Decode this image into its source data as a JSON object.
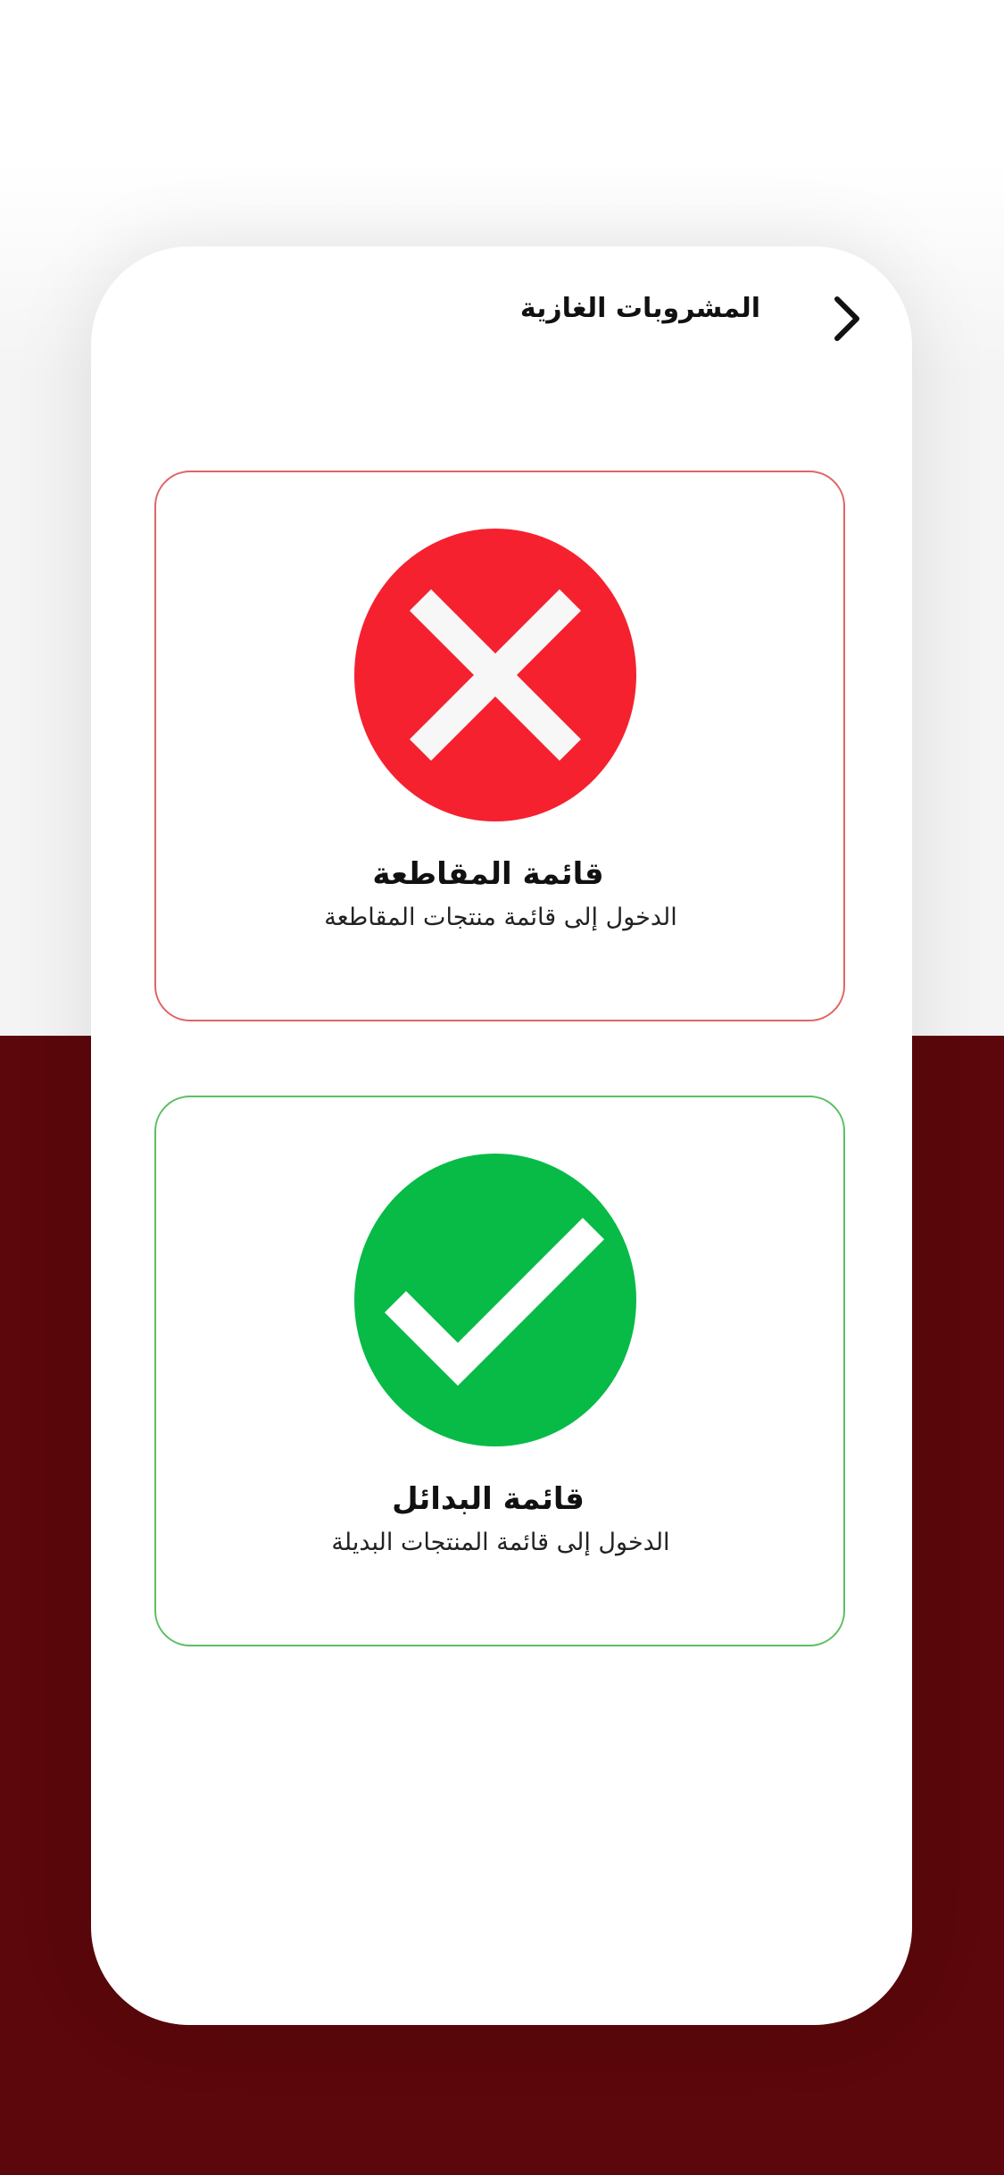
{
  "header": {
    "title": "المشروبات الغازية",
    "back_icon": "chevron-right-icon"
  },
  "cards": [
    {
      "title": "قائمة المقاطعة",
      "subtitle": "الدخول إلى قائمة منتجات المقاطعة",
      "icon": "x-circle-icon",
      "accent": "#f5212f",
      "border": "#e06464"
    },
    {
      "title": "قائمة البدائل",
      "subtitle": "الدخول إلى قائمة المنتجات البديلة",
      "icon": "check-circle-icon",
      "accent": "#07bb46",
      "border": "#5cbf63"
    }
  ],
  "colors": {
    "background_bottom": "#5b070b",
    "background_top": "#f4f4f4",
    "card_surface": "#ffffff"
  }
}
